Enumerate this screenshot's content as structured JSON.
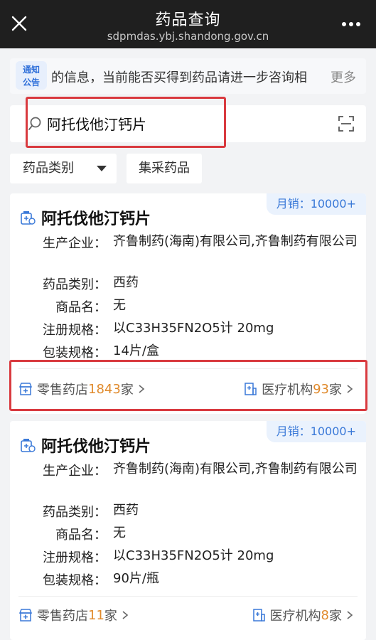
{
  "header": {
    "title": "药品查询",
    "url": "sdpmdas.ybj.shandong.gov.cn"
  },
  "notice": {
    "badge_line1": "通知",
    "badge_line2": "公告",
    "text": "的信息，当前能否买得到药品请进一步咨询相",
    "more": "更多"
  },
  "search": {
    "value": "阿托伐他汀钙片"
  },
  "filters": {
    "category_label": "药品类别",
    "procurement_label": "集采药品"
  },
  "results": [
    {
      "sales": "月销：10000+",
      "name": "阿托伐他汀钙片",
      "manufacturer_label": "生产企业：",
      "manufacturer": "齐鲁制药(海南)有限公司,齐鲁制药有限公司",
      "category_label": "药品类别：",
      "category": "西药",
      "trade_name_label": "商品名：",
      "trade_name": "无",
      "spec_label": "注册规格：",
      "spec": "以C33H35FN2O5计 20mg",
      "package_label": "包装规格：",
      "package": "14片/盒",
      "retail_label": "零售药店",
      "retail_count": "1843",
      "retail_unit": "家",
      "medical_label": "医疗机构",
      "medical_count": "93",
      "medical_unit": "家"
    },
    {
      "sales": "月销：10000+",
      "name": "阿托伐他汀钙片",
      "manufacturer_label": "生产企业：",
      "manufacturer": "齐鲁制药(海南)有限公司,齐鲁制药有限公司",
      "category_label": "药品类别：",
      "category": "西药",
      "trade_name_label": "商品名：",
      "trade_name": "无",
      "spec_label": "注册规格：",
      "spec": "以C33H35FN2O5计 20mg",
      "package_label": "包装规格：",
      "package": "90片/瓶",
      "retail_label": "零售药店",
      "retail_count": "11",
      "retail_unit": "家",
      "medical_label": "医疗机构",
      "medical_count": "8",
      "medical_unit": "家"
    }
  ],
  "colors": {
    "accent": "#3a79d8",
    "count": "#e08a2c",
    "highlight": "#d93a3f",
    "header_bg": "#1f1f1f"
  },
  "icons": [
    "close-icon",
    "more-dots-icon",
    "search-icon",
    "scan-icon",
    "caret-down-icon",
    "pill-icon",
    "pharmacy-icon",
    "hospital-icon",
    "chevron-right-icon"
  ]
}
